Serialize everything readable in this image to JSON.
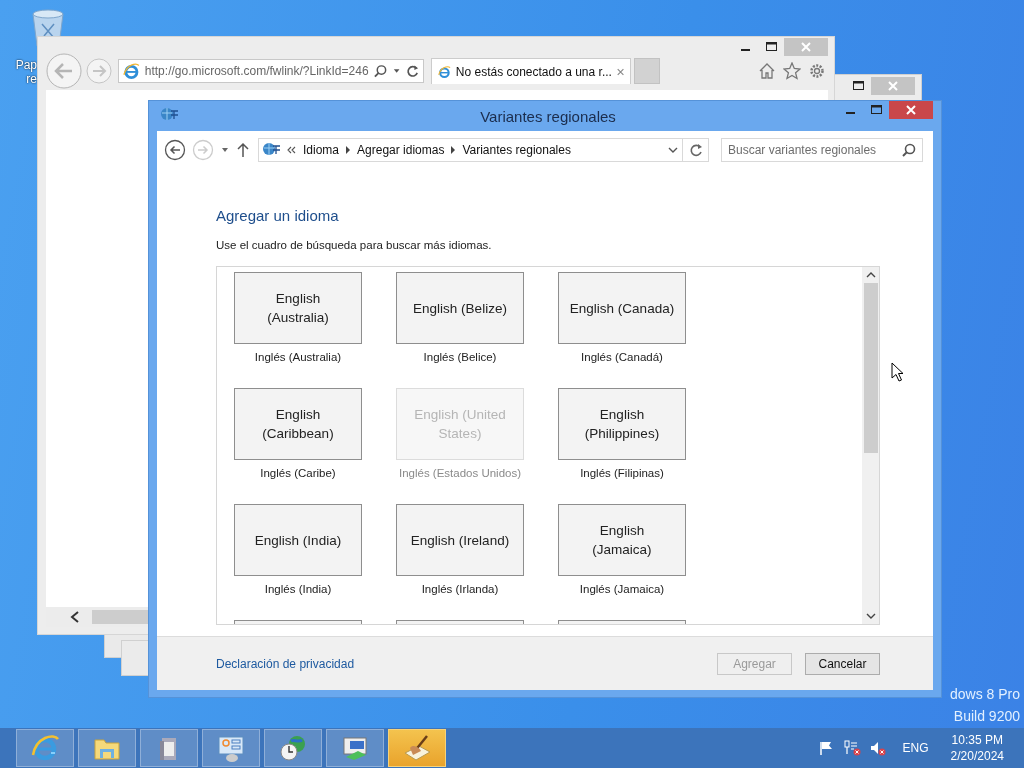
{
  "desktop": {
    "recycle_bin": {
      "label_lines": [
        "Pap",
        "re"
      ]
    },
    "edition_lines": [
      "dows 8 Pro",
      "Build 9200"
    ]
  },
  "browser": {
    "address": "http://go.microsoft.com/fwlink/?LinkId=246",
    "tabs": [
      {
        "title": "No estás conectado a una r...",
        "selected": true
      }
    ]
  },
  "dialog": {
    "title": "Variantes regionales",
    "breadcrumb": [
      "Idioma",
      "Agregar idiomas",
      "Variantes regionales"
    ],
    "search": {
      "placeholder": "Buscar variantes regionales"
    },
    "heading": "Agregar un idioma",
    "description": "Use el cuadro de búsqueda para buscar más idiomas.",
    "languages": [
      {
        "name": "English (Australia)",
        "caption": "Inglés (Australia)",
        "disabled": false
      },
      {
        "name": "English (Belize)",
        "caption": "Inglés (Belice)",
        "disabled": false
      },
      {
        "name": "English (Canada)",
        "caption": "Inglés (Canadá)",
        "disabled": false
      },
      {
        "name": "English (Caribbean)",
        "caption": "Inglés (Caribe)",
        "disabled": false
      },
      {
        "name": "English (United States)",
        "caption": "Inglés (Estados Unidos)",
        "disabled": true
      },
      {
        "name": "English (Philippines)",
        "caption": "Inglés (Filipinas)",
        "disabled": false
      },
      {
        "name": "English (India)",
        "caption": "Inglés (India)",
        "disabled": false
      },
      {
        "name": "English (Ireland)",
        "caption": "Inglés (Irlanda)",
        "disabled": false
      },
      {
        "name": "English (Jamaica)",
        "caption": "Inglés (Jamaica)",
        "disabled": false
      }
    ],
    "privacy_link": "Declaración de privacidad",
    "buttons": [
      {
        "label": "Agregar",
        "disabled": true
      },
      {
        "label": "Cancelar",
        "disabled": false
      }
    ]
  },
  "taskbar": {
    "apps": [
      {
        "kind": "browser",
        "selected": false
      },
      {
        "kind": "folder",
        "selected": false
      },
      {
        "kind": "library",
        "selected": false
      },
      {
        "kind": "control",
        "selected": false
      },
      {
        "kind": "clock",
        "selected": false
      },
      {
        "kind": "display",
        "selected": false
      },
      {
        "kind": "writing",
        "selected": true
      }
    ],
    "tray": {
      "language": "ENG",
      "time": "10:35 PM",
      "date": "2/20/2024"
    }
  }
}
